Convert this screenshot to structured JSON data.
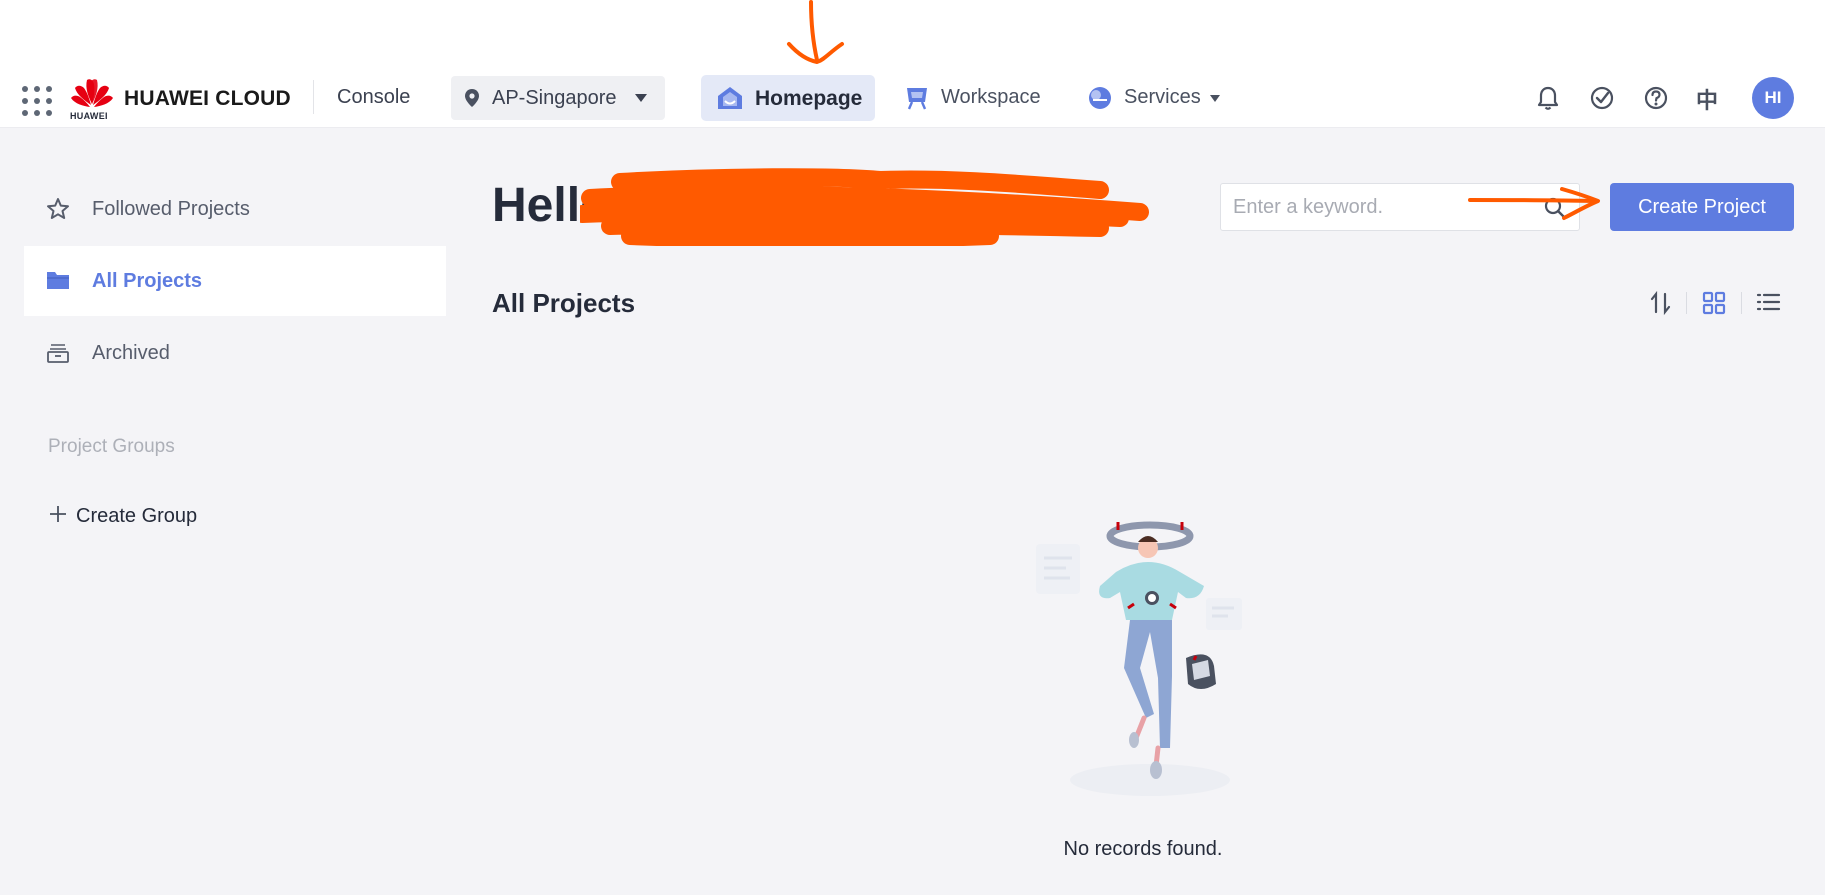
{
  "header": {
    "logo_text": "HUAWEI",
    "brand": "HUAWEI CLOUD",
    "console": "Console",
    "region": "AP-Singapore",
    "nav": {
      "homepage": "Homepage",
      "workspace": "Workspace",
      "services": "Services"
    },
    "language": "中",
    "avatar_initials": "HI"
  },
  "sidebar": {
    "items": [
      {
        "label": "Followed Projects",
        "icon": "star-icon"
      },
      {
        "label": "All Projects",
        "icon": "folder-icon",
        "active": true
      },
      {
        "label": "Archived",
        "icon": "archive-icon"
      }
    ],
    "groups_title": "Project Groups",
    "create_group": "Create Group"
  },
  "main": {
    "greeting": "Hello",
    "search_placeholder": "Enter a keyword.",
    "create_project": "Create Project",
    "section_title": "All Projects",
    "empty_text": "No records found."
  },
  "colors": {
    "accent": "#5e7ce0",
    "annotation": "#ff5a00",
    "background": "#f4f4f7"
  }
}
